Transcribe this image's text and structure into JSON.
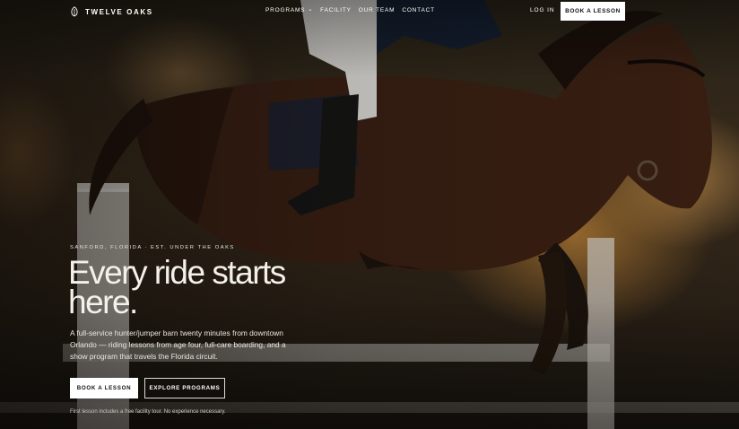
{
  "brand": {
    "name": "TWELVE OAKS",
    "icon": "oak-leaf-icon"
  },
  "nav": {
    "items": [
      {
        "label": "PROGRAMS",
        "has_dropdown": true
      },
      {
        "label": "FACILITY",
        "has_dropdown": false
      },
      {
        "label": "OUR TEAM",
        "has_dropdown": false
      },
      {
        "label": "CONTACT",
        "has_dropdown": false
      }
    ],
    "login_label": "LOG IN",
    "cta_label": "BOOK A LESSON"
  },
  "hero": {
    "eyebrow": "SANFORD, FLORIDA · EST. UNDER THE OAKS",
    "headline": "Every ride starts here.",
    "lede": "A full-service hunter/jumper barn twenty minutes from downtown Orlando — riding lessons from age four, full-care boarding, and a show program that travels the Florida circuit.",
    "primary_cta": "BOOK A LESSON",
    "secondary_cta": "EXPLORE PROGRAMS",
    "footnote": "First lesson includes a free facility tour. No experience necessary."
  },
  "colors": {
    "background": "#2a2418",
    "button_bg": "#ffffff",
    "button_text": "#111111",
    "glow": "#c98a3a"
  }
}
